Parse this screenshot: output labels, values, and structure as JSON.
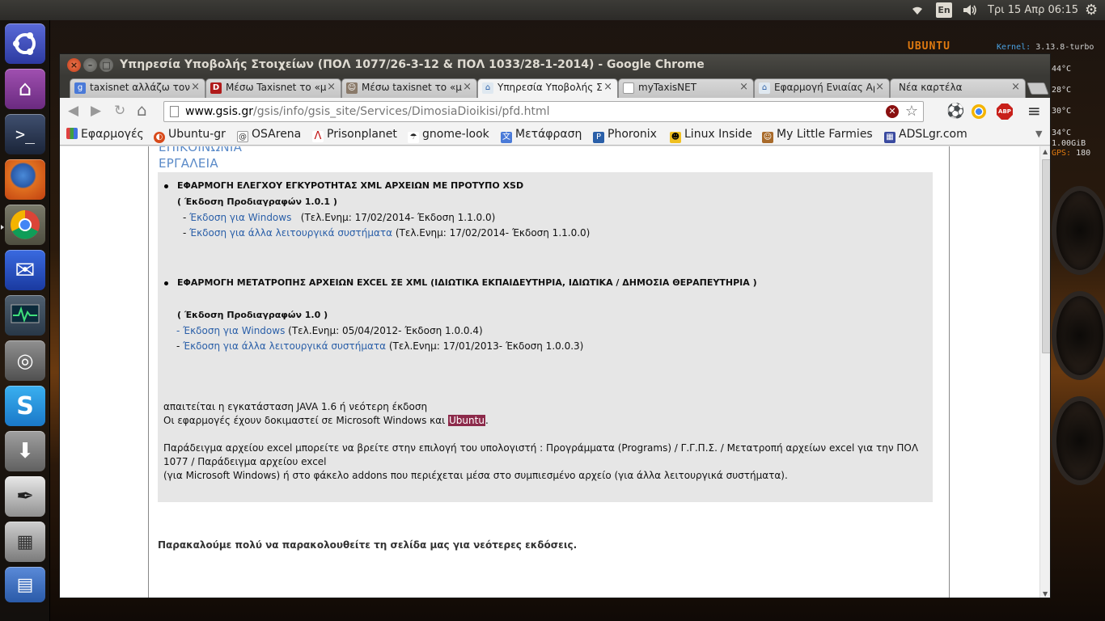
{
  "top_panel": {
    "keyboard": "En",
    "clock": "Τρι 15 Απρ 06:15"
  },
  "conky": {
    "distro": "UBUNTU",
    "kernel_label": "Kernel:",
    "kernel_value": "3.13.8-turbo",
    "values": [
      "44°C",
      "28°C",
      "30°C",
      "34°C",
      "1.00GiB",
      "180"
    ],
    "gps_label": "GPS:"
  },
  "launcher": {
    "items": [
      "ubuntu-dash-icon",
      "home-folder-icon",
      "terminal-icon",
      "firefox-icon",
      "chrome-icon",
      "mail-icon",
      "system-monitor-icon",
      "disk-utility-icon",
      "skype-icon",
      "software-updater-icon",
      "inkscape-icon",
      "desktop-stack-icon"
    ]
  },
  "window": {
    "title": "Υπηρεσία Υποβολής Στοιχείων (ΠΟΛ 1077/26-3-12 & ΠΟΛ 1033/28-1-2014) - Google Chrome"
  },
  "tabs": [
    {
      "label": "taxisnet αλλάζω τον c",
      "favicon": "google-icon",
      "active": false
    },
    {
      "label": "Μέσω Taxisnet το «μ",
      "favicon": "d-site-icon",
      "active": false
    },
    {
      "label": "Μέσω taxisnet το «μέ",
      "favicon": "ubuntu-gr-icon",
      "active": false
    },
    {
      "label": "Υπηρεσία Υποβολής Σ",
      "favicon": "gsis-icon",
      "active": true
    },
    {
      "label": "myTaxisNET",
      "favicon": "page-icon",
      "active": false
    },
    {
      "label": "Εφαρμογή Ενιαίας Αρ",
      "favicon": "gsis-icon",
      "active": false
    },
    {
      "label": "Νέα καρτέλα",
      "favicon": "",
      "active": false
    }
  ],
  "toolbar": {
    "url_host": "www.gsis.gr",
    "url_path": "/gsis/info/gsis_site/Services/DimosiaDioikisi/pfd.html",
    "abp_label": "ABP"
  },
  "bookmarks": [
    {
      "label": "Εφαρμογές",
      "icon": "apps-grid-icon"
    },
    {
      "label": "Ubuntu-gr",
      "icon": "ubuntu-gr-icon"
    },
    {
      "label": "OSArena",
      "icon": "osarena-icon"
    },
    {
      "label": "Prisonplanet",
      "icon": "prisonplanet-icon"
    },
    {
      "label": "gnome-look",
      "icon": "gnome-look-icon"
    },
    {
      "label": "Μετάφραση",
      "icon": "translate-icon"
    },
    {
      "label": "Phoronix",
      "icon": "phoronix-icon"
    },
    {
      "label": "Linux Inside",
      "icon": "tux-icon"
    },
    {
      "label": "My Little Farmies",
      "icon": "farmies-icon"
    },
    {
      "label": "ADSLgr.com",
      "icon": "adslgr-icon"
    }
  ],
  "page": {
    "partial_heading": "ΕΠΙΚΟΙΝΩΝΙΑ",
    "section_heading": "ΕΡΓΑΛΕΙΑ",
    "app1": {
      "title": "ΕΦΑΡΜΟΓΗ ΕΛΕΓΧΟΥ ΕΓΚΥΡΟΤΗΤΑΣ XML ΑΡΧΕΙΩΝ ΜΕ ΠΡΟΤΥΠΟ XSD",
      "spec": "( Έκδοση Προδιαγραφών 1.0.1 )",
      "link_windows": "Έκδοση για Windows",
      "info_windows": "(Τελ.Ενημ: 17/02/2014- Έκδοση 1.1.0.0)",
      "link_other": "Έκδοση για άλλα λειτουργικά συστήματα",
      "info_other": "(Τελ.Ενημ: 17/02/2014- Έκδοση 1.1.0.0)"
    },
    "app2": {
      "title": "ΕΦΑΡΜΟΓΗ ΜΕΤΑΤΡΟΠΗΣ ΑΡΧΕΙΩΝ EXCEL ΣΕ XML (ΙΔΙΩΤΙΚΑ ΕΚΠΑΙΔΕΥΤΗΡΙΑ, ΙΔΙΩΤΙΚΑ / ΔΗΜΟΣΙΑ ΘΕΡΑΠΕΥΤΗΡΙΑ )",
      "spec": "( Έκδοση Προδιαγραφών 1.0 )",
      "link_windows": "- Έκδοση για Windows",
      "info_windows": "(Τελ.Ενημ: 05/04/2012- Έκδοση 1.0.0.4)",
      "link_other": "Έκδοση για άλλα λειτουργικά συστήματα",
      "info_other": "(Τελ.Ενημ: 17/01/2013- Έκδοση 1.0.0.3)"
    },
    "java_note": "απαιτείται η εγκατάσταση JAVA 1.6 ή νεότερη έκδοση",
    "tested_note_prefix": "Οι εφαρμογές έχουν δοκιμαστεί σε Microsoft Windows και ",
    "tested_note_highlight": "Ubuntu",
    "tested_note_suffix": ".",
    "example_line1": "Παράδειγμα αρχείου excel μπορείτε να βρείτε στην επιλογή του υπολογιστή : Προγράμματα (Programs) / Γ.Γ.Π.Σ. / Μετατροπή αρχείων excel για την ΠΟΛ",
    "example_line2": "1077 / Παράδειγμα αρχείου excel",
    "example_line3": "(για Microsoft Windows) ή στο φάκελο addons που περιέχεται μέσα στο συμπιεσμένο αρχείο (για άλλα λειτουργικά συστήματα).",
    "footer": "Παρακαλούμε πολύ να παρακολουθείτε τη σελίδα μας για νεότερες εκδόσεις."
  }
}
